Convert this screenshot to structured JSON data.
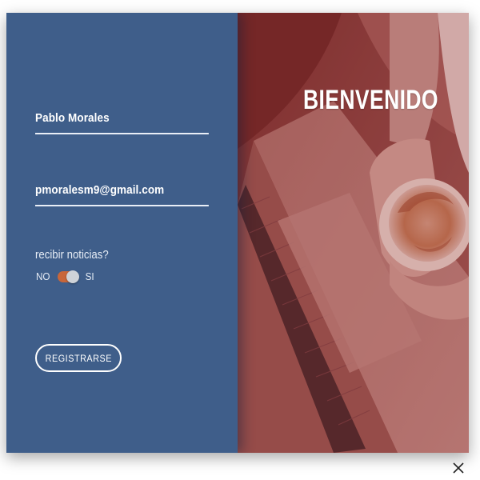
{
  "form": {
    "name_value": "Pablo Morales",
    "email_value": "pmoralesm9@gmail.com",
    "question": "recibir noticias?",
    "toggle": {
      "off_label": "NO",
      "on_label": "SI",
      "state": "on"
    },
    "register_label": "REGISTRARSE"
  },
  "hero": {
    "title": "BIENVENIDO"
  },
  "icons": {
    "close": "close-icon",
    "toggle_knob": "toggle-knob"
  },
  "colors": {
    "form_background": "#3f5e8a",
    "toggle_accent": "#c8663a",
    "image_tint": "#8a4a4a",
    "text": "#ffffff"
  }
}
